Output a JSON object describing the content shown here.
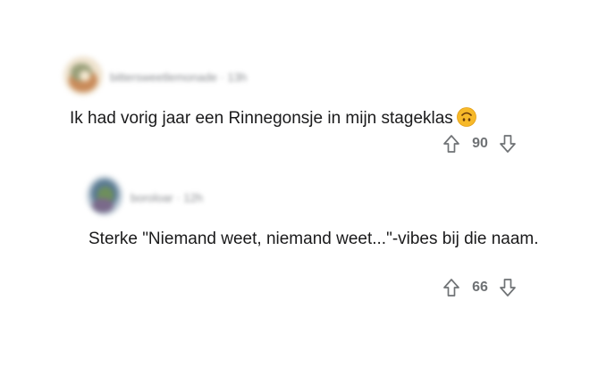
{
  "comments": [
    {
      "author": "bittersweetlemonade",
      "time": "13h",
      "text": "Ik had vorig jaar een Rinnegonsje in mijn stageklas",
      "emoji": "upside-down-face-emoji",
      "score": "90",
      "avatar_colors": [
        "#e7c9a2",
        "#9aa07a",
        "#c98b5a"
      ]
    },
    {
      "author": "boroloar",
      "time": "12h",
      "text": "Sterke \"Niemand weet, niemand weet...\"-vibes bij die naam.",
      "score": "66",
      "avatar_colors": [
        "#5a7a92",
        "#6e8f5c",
        "#7a6a8a"
      ]
    }
  ],
  "icons": {
    "upvote": "arrow-up-outline-icon",
    "downvote": "arrow-down-outline-icon"
  },
  "colors": {
    "text": "#1a1a1b",
    "muted": "#8a8d91",
    "vote": "#6f7275"
  }
}
